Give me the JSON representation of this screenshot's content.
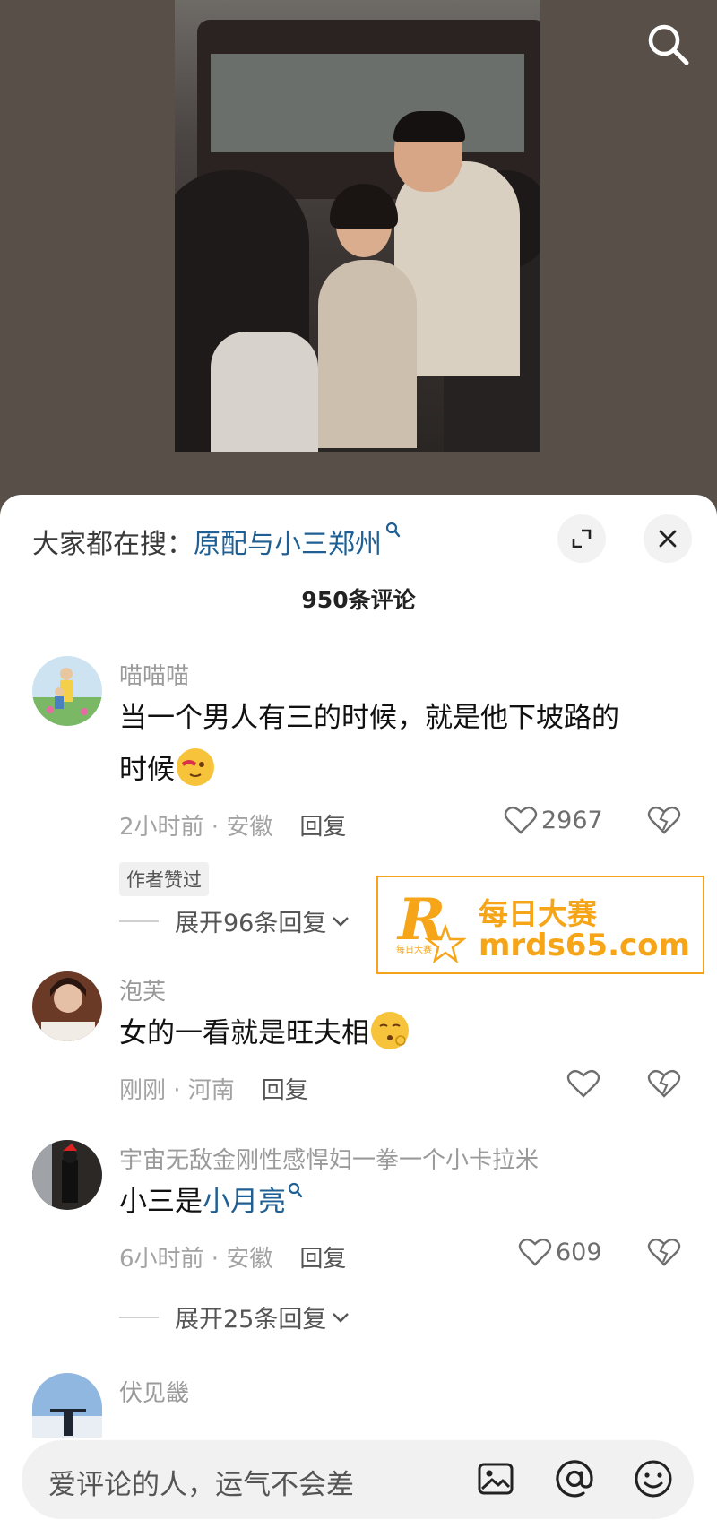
{
  "video": {
    "description_icons": [
      "search-icon"
    ]
  },
  "panel": {
    "trending_prefix": "大家都在搜：",
    "trending_query": "原配与小三郑州",
    "comment_count": "950条评论"
  },
  "comments": [
    {
      "author": "喵喵喵",
      "text_line1": "当一个男人有三的时候，就是他下坡路的",
      "text_line2": "时候",
      "time_location": "2小时前 · 安徽",
      "reply_label": "回复",
      "likes": "2967",
      "tag": "作者赞过",
      "expand_label": "展开96条回复"
    },
    {
      "author": "泡芙",
      "text": "女的一看就是旺夫相",
      "time_location": "刚刚 · 河南",
      "reply_label": "回复",
      "likes": ""
    },
    {
      "author": "宇宙无敌金刚性感悍妇一拳一个小卡拉米",
      "text_prefix": "小三是",
      "text_link": "小月亮",
      "time_location": "6小时前 · 安徽",
      "reply_label": "回复",
      "likes": "609",
      "expand_label": "展开25条回复"
    },
    {
      "author": "伏见畿"
    }
  ],
  "watermark": {
    "letter": "R",
    "cn": "每日大赛",
    "url": "mrds65.com",
    "small": "每日大赛"
  },
  "input": {
    "placeholder": "爱评论的人，运气不会差"
  },
  "colors": {
    "link": "#1f5f93",
    "watermark": "#f6a518"
  }
}
